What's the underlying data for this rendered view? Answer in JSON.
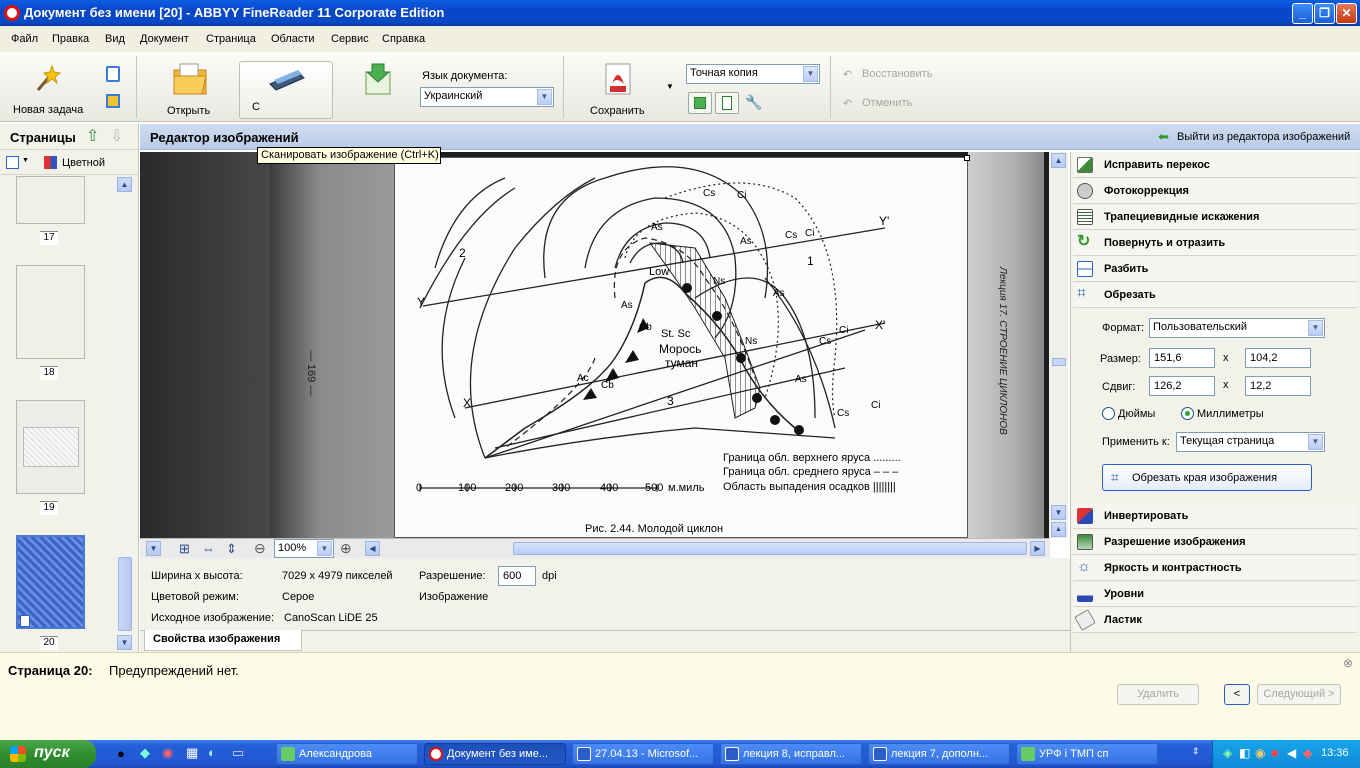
{
  "window": {
    "title": "Документ без имени [20] - ABBYY FineReader 11 Corporate Edition"
  },
  "menu": [
    "Файл",
    "Правка",
    "Вид",
    "Документ",
    "Страница",
    "Области",
    "Сервис",
    "Справка"
  ],
  "toolbar": {
    "new_task": "Новая задача",
    "open": "Открыть",
    "scan_short": "С",
    "tooltip": "Сканировать изображение (Ctrl+K)",
    "doc_lang_label": "Язык документа:",
    "doc_lang_value": "Украинский",
    "save": "Сохранить",
    "save_mode": "Точная копия",
    "restore": "Восстановить",
    "cancel": "Отменить"
  },
  "pages_panel": {
    "title": "Страницы",
    "color_mode": "Цветной",
    "pages": [
      "17",
      "18",
      "19",
      "20"
    ],
    "current_page": "20"
  },
  "editor": {
    "title": "Редактор изображений",
    "exit": "Выйти из редактора изображений",
    "zoom": "100%",
    "image_labels": {
      "two": "2",
      "one": "1",
      "three": "3",
      "Y": "Y",
      "Yp": "Y'",
      "X": "X",
      "Xp": "X'",
      "cs1": "Cs",
      "ci1": "Ci",
      "cs2": "Cs",
      "ci2": "Ci",
      "as1": "As",
      "as2": "As",
      "as3": "As",
      "as4": "As",
      "low": "Low",
      "ns1": "Ns",
      "ns2": "Ns",
      "cb1": "Cb",
      "cb2": "Cb",
      "ac": "Ac",
      "stsc": "St. Sc",
      "moros": "Морось",
      "tuman": "туман",
      "ci3": "Ci",
      "cs3": "Cs",
      "ci4": "Ci",
      "cs4": "Cs",
      "scale": [
        "0",
        "100",
        "200",
        "300",
        "400",
        "500"
      ],
      "scale_unit": "м.миль",
      "legend1": "Граница обл. верхнего яруса .........",
      "legend2": "Граница обл. среднего яруса – – –",
      "legend3": "Область выпадения осадков ||||||||",
      "caption": "Рис. 2.44. Молодой циклон",
      "side_text": "Лекция 17. СТРОЕНИЕ ЦИКЛОНОВ",
      "page_number": "— 169 —"
    }
  },
  "properties": {
    "size_label": "Ширина x высота:",
    "size_value": "7029 x 4979 пикселей",
    "color_label": "Цветовой режим:",
    "color_value": "Серое",
    "source_label": "Исходное изображение:",
    "source_value": "CanoScan LiDE 25",
    "res_label": "Разрешение:",
    "res_value": "600",
    "res_unit": "dpi",
    "image_word": "Изображение",
    "tab": "Свойства изображения"
  },
  "right_panel": {
    "items_top": [
      "Исправить перекос",
      "Фотокоррекция",
      "Трапециевидные искажения",
      "Повернуть и отразить",
      "Разбить",
      "Обрезать"
    ],
    "crop": {
      "format_label": "Формат:",
      "format_value": "Пользовательский",
      "size_label": "Размер:",
      "size_w": "151,6",
      "size_h": "104,2",
      "shift_label": "Сдвиг:",
      "shift_x": "126,2",
      "shift_y": "12,2",
      "x_sep": "x",
      "unit_inches": "Дюймы",
      "unit_mm": "Миллиметры",
      "apply_label": "Применить к:",
      "apply_value": "Текущая страница",
      "crop_button": "Обрезать края изображения"
    },
    "items_bottom": [
      "Инвертировать",
      "Разрешение изображения",
      "Яркость и контрастность",
      "Уровни",
      "Ластик"
    ]
  },
  "status": {
    "page_label": "Страница 20:",
    "message": "Предупреждений нет.",
    "delete": "Удалить",
    "prev": "<",
    "next": "Следующий >"
  },
  "taskbar": {
    "start": "пуск",
    "tasks": [
      "Александрова",
      "Документ без име...",
      "27.04.13 - Microsof...",
      "лекция 8, исправл...",
      "лекция 7, дополн...",
      "УРФ і ТМП сп"
    ],
    "clock": "13:36"
  },
  "colors": {
    "accent": "#0a5fe0",
    "panel_header": "#c3d3ea",
    "taskbar": "#245fd8",
    "start": "#2f8e2f"
  }
}
